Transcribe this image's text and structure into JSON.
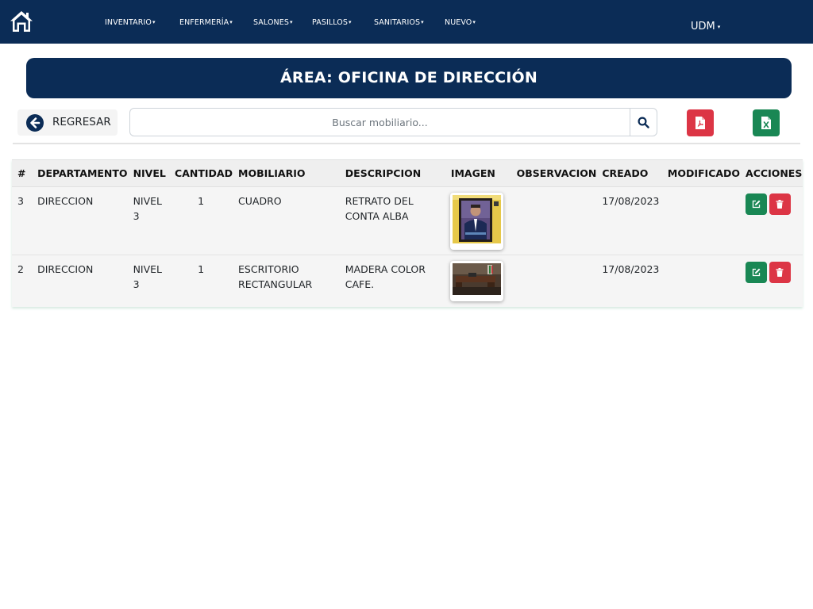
{
  "navbar": {
    "home_icon": "home-icon",
    "menus": [
      {
        "label": "INVENTARIO"
      },
      {
        "label": "ENFERMERÍA"
      },
      {
        "label": "SALONES"
      },
      {
        "label": "PASILLOS"
      },
      {
        "label": "SANITARIOS"
      },
      {
        "label": "NUEVO"
      }
    ],
    "user_menu": "UDM",
    "caret": "▾",
    "background": "#0b2c56"
  },
  "header": {
    "title": "ÁREA: OFICINA DE DIRECCIÓN"
  },
  "toolbar": {
    "back_label": "REGRESAR",
    "search_placeholder": "Buscar mobiliario...",
    "search_value": "",
    "pdf_icon": "file-pdf-icon",
    "excel_icon": "file-excel-icon",
    "pdf_color": "#dc3545",
    "excel_color": "#198754"
  },
  "table": {
    "columns": [
      "#",
      "DEPARTAMENTO",
      "NIVEL",
      "CANTIDAD",
      "MOBILIARIO",
      "DESCRIPCION",
      "IMAGEN",
      "OBSERVACION",
      "CREADO",
      "MODIFICADO",
      "ACCIONES"
    ],
    "rows": [
      {
        "id": "3",
        "departamento": "DIRECCION",
        "nivel": "NIVEL 3",
        "cantidad": "1",
        "mobiliario": "CUADRO",
        "descripcion": "RETRATO DEL CONTA ALBA",
        "imagen": "framed-portrait-photo",
        "observacion": "",
        "creado": "17/08/2023",
        "modificado": ""
      },
      {
        "id": "2",
        "departamento": "DIRECCION",
        "nivel": "NIVEL 3",
        "cantidad": "1",
        "mobiliario": "ESCRITORIO RECTANGULAR",
        "descripcion": "MADERA COLOR CAFE.",
        "imagen": "office-desk-photo",
        "observacion": "",
        "creado": "17/08/2023",
        "modificado": ""
      }
    ],
    "action_icons": [
      "edit-icon",
      "trash-icon"
    ]
  }
}
